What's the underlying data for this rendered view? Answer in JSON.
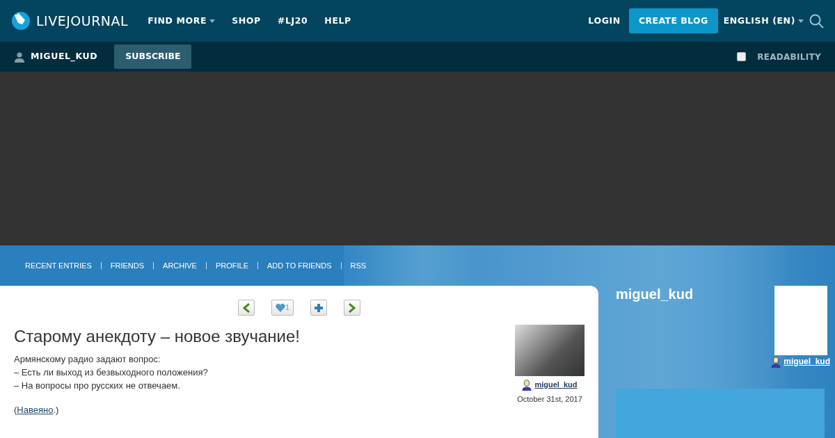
{
  "header": {
    "logo_text": "LIVEJOURNAL",
    "nav": [
      {
        "label": "FIND MORE",
        "dropdown": true
      },
      {
        "label": "SHOP",
        "dropdown": false
      },
      {
        "label": "#LJ20",
        "dropdown": false
      },
      {
        "label": "HELP",
        "dropdown": false
      }
    ],
    "login": "LOGIN",
    "create_blog": "CREATE BLOG",
    "language": "ENGLISH (EN)"
  },
  "subbar": {
    "username": "MIGUEL_KUD",
    "subscribe": "SUBSCRIBE",
    "readability": {
      "label": "READABILITY",
      "checked": false
    }
  },
  "journal_nav": [
    "RECENT ENTRIES",
    "FRIENDS",
    "ARCHIVE",
    "PROFILE",
    "ADD TO FRIENDS",
    "RSS"
  ],
  "entry": {
    "like_count": "1",
    "title": "Старому анекдоту – новое звучание!",
    "lines": [
      "Армянскому радио задают вопрос:",
      "– Есть ли выход из безвыходного положения?",
      "– На вопросы про русских не отвечаем."
    ],
    "source": {
      "before": "(",
      "link": "Навеяно",
      "after": ".)"
    },
    "author": "miguel_kud",
    "date": "October 31st, 2017"
  },
  "sidebar": {
    "title": "miguel_kud",
    "username": "miguel_kud"
  }
}
